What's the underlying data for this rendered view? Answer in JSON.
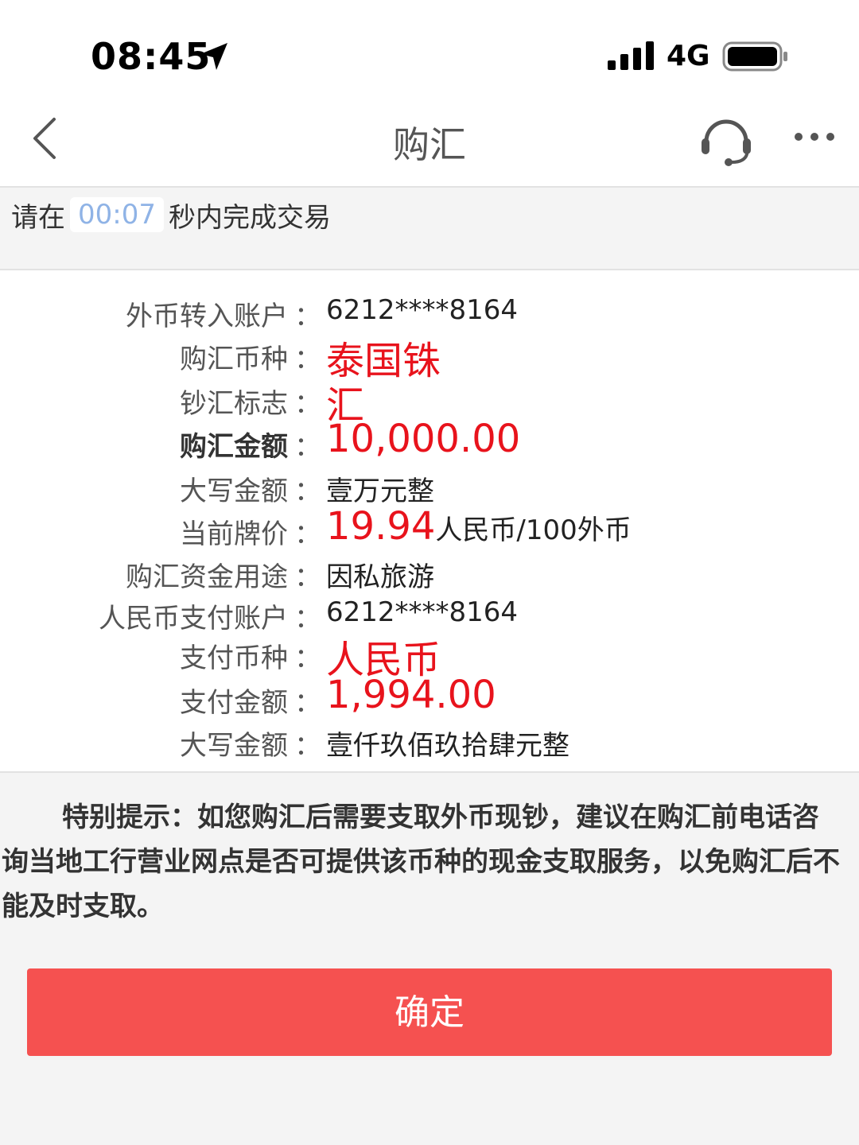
{
  "status_bar": {
    "time": "08:45",
    "network": "4G"
  },
  "nav": {
    "title": "购汇"
  },
  "countdown": {
    "prefix": "请在",
    "timer": "00:07",
    "suffix": "秒内完成交易"
  },
  "details": [
    {
      "label": "外币转入账户",
      "colon": "：",
      "value": "6212****8164",
      "style": "normal"
    },
    {
      "label": "购汇币种",
      "colon": "：",
      "value": "泰国铢",
      "style": "red-big"
    },
    {
      "label": "钞汇标志",
      "colon": "：",
      "value": "汇",
      "style": "red-big"
    },
    {
      "label": "购汇金额",
      "colon": "：",
      "value": "10,000.00",
      "style": "red-big",
      "label_bold": true
    },
    {
      "label": "大写金额",
      "colon": "：",
      "value": "壹万元整",
      "style": "normal"
    },
    {
      "label": "当前牌价",
      "colon": "：",
      "value": "19.94",
      "unit": "人民币/100外币",
      "style": "red-big"
    },
    {
      "label": "购汇资金用途",
      "colon": "：",
      "value": "因私旅游",
      "style": "normal"
    },
    {
      "label": "人民币支付账户",
      "colon": "：",
      "value": "6212****8164",
      "style": "normal"
    },
    {
      "label": "支付币种",
      "colon": "：",
      "value": "人民币",
      "style": "red-big"
    },
    {
      "label": "支付金额",
      "colon": "：",
      "value": "1,994.00",
      "style": "red-big"
    },
    {
      "label": "大写金额",
      "colon": "：",
      "value": "壹仟玖佰玖拾肆元整",
      "style": "normal"
    }
  ],
  "notice": "特别提示：如您购汇后需要支取外币现钞，建议在购汇前电话咨询当地工行营业网点是否可提供该币种的现金支取服务，以免购汇后不能及时支取。",
  "confirm_label": "确定",
  "colors": {
    "accent_red": "#e8131c",
    "button_red": "#f55150",
    "timer_blue": "#8fb3e6"
  },
  "icons": [
    "location-arrow-icon",
    "signal-icon",
    "battery-icon",
    "back-chevron-icon",
    "headset-icon",
    "more-icon"
  ]
}
